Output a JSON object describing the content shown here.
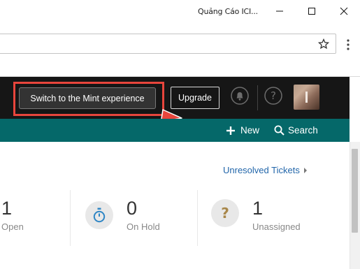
{
  "window": {
    "title": "Quảng Cáo ICI...",
    "minimize_icon": "minimize-icon",
    "maximize_icon": "maximize-icon",
    "close_icon": "close-icon"
  },
  "browser": {
    "url_value": "",
    "bookmark_icon": "star-icon",
    "menu_icon": "kebab-menu-icon"
  },
  "header": {
    "switch_label": "Switch to the Mint experience",
    "upgrade_label": "Upgrade",
    "bell_icon": "bell-icon",
    "help_icon": "help-icon",
    "avatar_initial": "I"
  },
  "nav": {
    "new_label": "New",
    "search_label": "Search",
    "plus_icon": "plus-icon",
    "search_icon": "search-icon"
  },
  "content": {
    "unresolved_link": "Unresolved Tickets",
    "stats": [
      {
        "value": "1",
        "label": "Open"
      },
      {
        "value": "0",
        "label": "On Hold"
      },
      {
        "value": "1",
        "label": "Unassigned"
      }
    ]
  },
  "colors": {
    "header_bg": "#161616",
    "nav_bg": "#056869",
    "highlight": "#e8453c",
    "link": "#2266aa"
  }
}
